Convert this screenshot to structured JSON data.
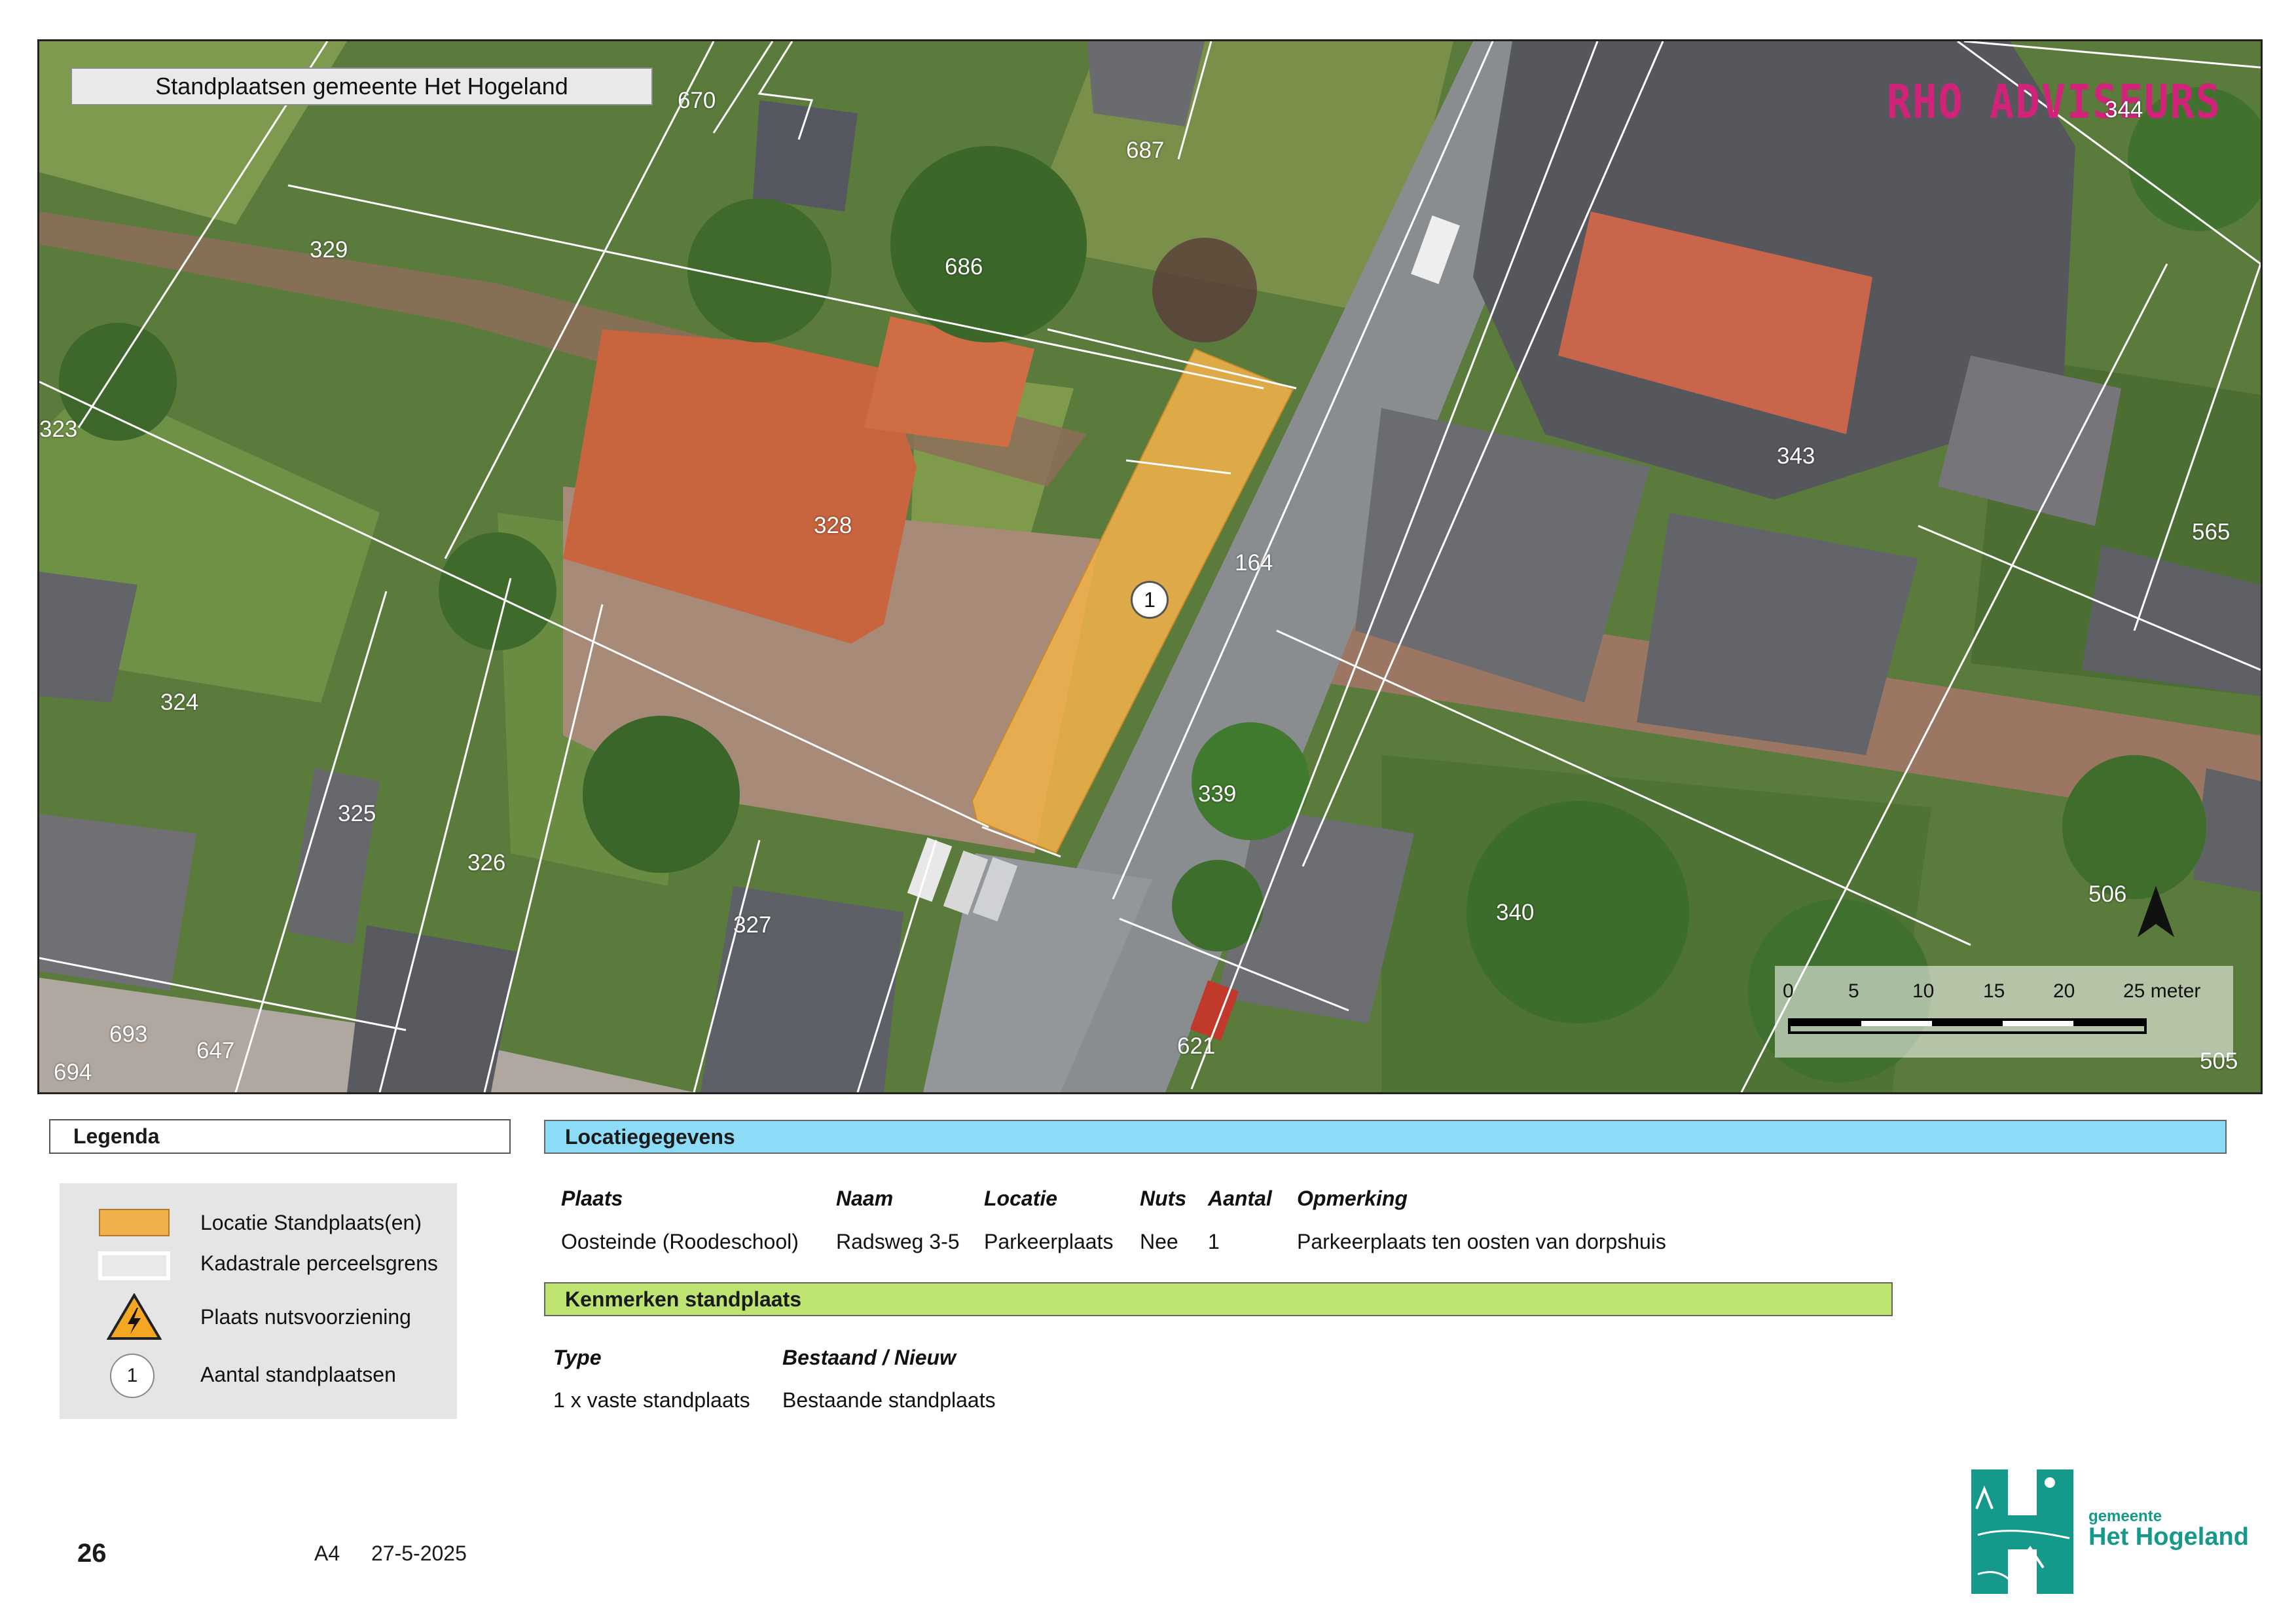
{
  "map": {
    "title": "Standplaatsen gemeente Het Hogeland",
    "brand": "RHO ADVISEURS",
    "parcels": [
      "670",
      "687",
      "329",
      "686",
      "323",
      "328",
      "164",
      "343",
      "565",
      "324",
      "325",
      "326",
      "339",
      "327",
      "340",
      "506",
      "693",
      "647",
      "694",
      "621",
      "505",
      "344"
    ],
    "count_marker": "1",
    "north_arrow_icon": "north-arrow-icon",
    "scale": {
      "ticks": [
        "0",
        "5",
        "10",
        "15",
        "20",
        "25 meter"
      ]
    },
    "colors": {
      "standplaats": "#f0b04a",
      "parcel_line": "#ffffff"
    }
  },
  "legend": {
    "title": "Legenda",
    "items": [
      {
        "label": "Locatie Standplaats(en)",
        "icon": "orange-area-swatch"
      },
      {
        "label": "Kadastrale perceelsgrens",
        "icon": "parcel-boundary-swatch"
      },
      {
        "label": "Plaats nutsvoorziening",
        "icon": "electricity-warning-icon"
      },
      {
        "label": "Aantal standplaatsen",
        "icon": "count-circle-icon",
        "symbol": "1"
      }
    ]
  },
  "location": {
    "title": "Locatiegegevens",
    "headers": [
      "Plaats",
      "Naam",
      "Locatie",
      "Nuts",
      "Aantal",
      "Opmerking"
    ],
    "row": [
      "Oosteinde (Roodeschool)",
      "Radsweg 3-5",
      "Parkeerplaats",
      "Nee",
      "1",
      "Parkeerplaats ten oosten van dorpshuis"
    ]
  },
  "kenmerken": {
    "title": "Kenmerken standplaats",
    "headers": [
      "Type",
      "Bestaand / Nieuw"
    ],
    "row": [
      "1 x vaste standplaats",
      "Bestaande standplaats"
    ]
  },
  "footer": {
    "page": "26",
    "paper": "A4",
    "date": "27-5-2025",
    "logo_line1": "gemeente",
    "logo_line2": "Het Hogeland"
  }
}
